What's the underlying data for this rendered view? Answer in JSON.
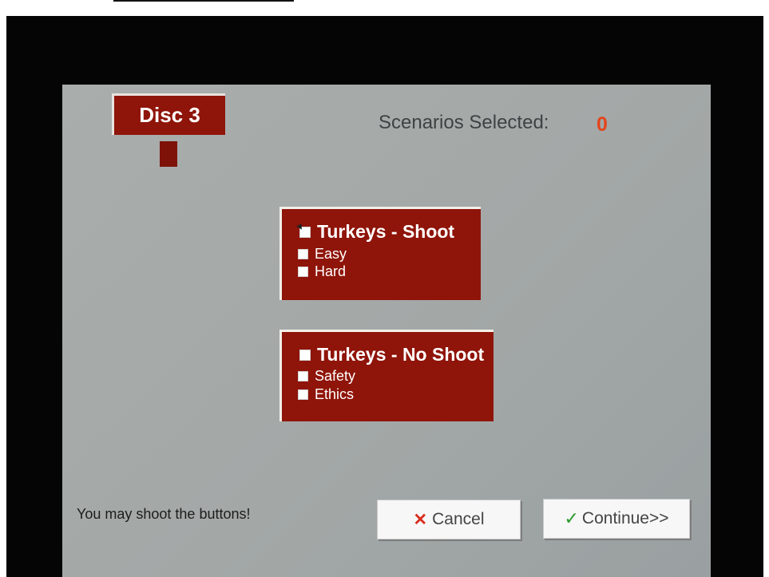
{
  "header": {
    "disc_label": "Disc 3",
    "scenarios_label": "Scenarios Selected:",
    "scenarios_count": "0"
  },
  "groups": [
    {
      "title": "Turkeys - Shoot",
      "checked": false,
      "options": [
        {
          "label": "Easy",
          "checked": false
        },
        {
          "label": "Hard",
          "checked": false
        }
      ]
    },
    {
      "title": "Turkeys - No Shoot",
      "checked": false,
      "options": [
        {
          "label": "Safety",
          "checked": false
        },
        {
          "label": "Ethics",
          "checked": false
        }
      ]
    }
  ],
  "footer": {
    "hint": "You may shoot the buttons!",
    "cancel_label": "Cancel",
    "continue_label": "Continue>>"
  },
  "icons": {
    "cancel": "x-icon",
    "continue": "check-icon"
  },
  "colors": {
    "panel": "#8f1409",
    "count": "#e4441c",
    "screen": "#a5a9a9"
  }
}
